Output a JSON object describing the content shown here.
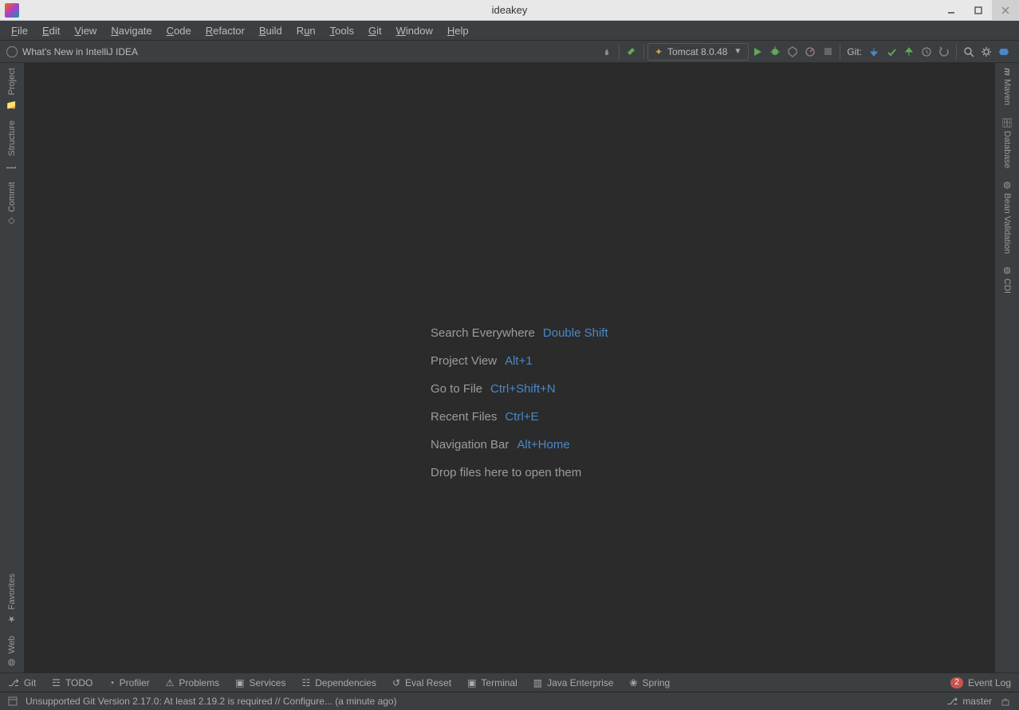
{
  "window": {
    "title": "ideakey"
  },
  "menu": {
    "items": [
      "File",
      "Edit",
      "View",
      "Navigate",
      "Code",
      "Refactor",
      "Build",
      "Run",
      "Tools",
      "Git",
      "Window",
      "Help"
    ]
  },
  "nav": {
    "crumb": "What's New in IntelliJ IDEA",
    "run_config": "Tomcat 8.0.48",
    "git_label": "Git:"
  },
  "left_stripe": {
    "top": [
      {
        "label": "Project",
        "name": "project"
      },
      {
        "label": "Structure",
        "name": "structure"
      },
      {
        "label": "Commit",
        "name": "commit"
      }
    ],
    "bottom": [
      {
        "label": "Favorites",
        "name": "favorites"
      },
      {
        "label": "Web",
        "name": "web"
      }
    ]
  },
  "right_stripe": {
    "top": [
      {
        "label": "Maven",
        "name": "maven"
      },
      {
        "label": "Database",
        "name": "database"
      },
      {
        "label": "Bean Validation",
        "name": "bean-validation"
      },
      {
        "label": "CDI",
        "name": "cdi"
      }
    ]
  },
  "hints": [
    {
      "label": "Search Everywhere",
      "shortcut": "Double Shift"
    },
    {
      "label": "Project View",
      "shortcut": "Alt+1"
    },
    {
      "label": "Go to File",
      "shortcut": "Ctrl+Shift+N"
    },
    {
      "label": "Recent Files",
      "shortcut": "Ctrl+E"
    },
    {
      "label": "Navigation Bar",
      "shortcut": "Alt+Home"
    }
  ],
  "drop_hint": "Drop files here to open them",
  "toolwin": {
    "items": [
      {
        "label": "Git",
        "name": "git",
        "icon": "branch"
      },
      {
        "label": "TODO",
        "name": "todo",
        "icon": "list"
      },
      {
        "label": "Profiler",
        "name": "profiler",
        "icon": "gauge"
      },
      {
        "label": "Problems",
        "name": "problems",
        "icon": "warning"
      },
      {
        "label": "Services",
        "name": "services",
        "icon": "play"
      },
      {
        "label": "Dependencies",
        "name": "dependencies",
        "icon": "stack"
      },
      {
        "label": "Eval Reset",
        "name": "eval-reset",
        "icon": "undo"
      },
      {
        "label": "Terminal",
        "name": "terminal",
        "icon": "terminal"
      },
      {
        "label": "Java Enterprise",
        "name": "java-enterprise",
        "icon": "box"
      },
      {
        "label": "Spring",
        "name": "spring",
        "icon": "leaf"
      }
    ],
    "event_log": {
      "label": "Event Log",
      "count": "2"
    }
  },
  "status": {
    "message": "Unsupported Git Version 2.17.0: At least 2.19.2 is required // Configure... (a minute ago)",
    "branch": "master"
  }
}
